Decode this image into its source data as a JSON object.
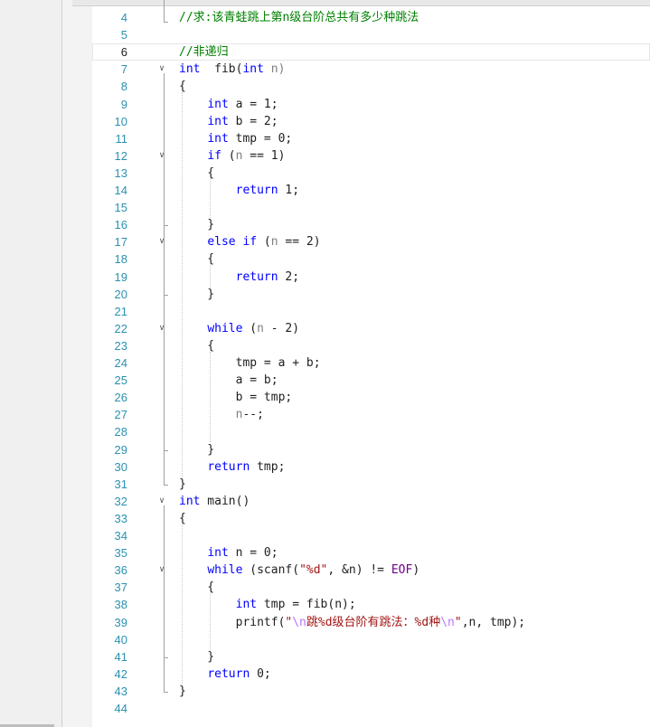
{
  "editor": {
    "lines": [
      {
        "n": "4",
        "segs": [
          {
            "t": "//求:该青蛙跳上第n级台阶总共有多少种跳法",
            "c": "cm"
          }
        ]
      },
      {
        "n": "5",
        "segs": []
      },
      {
        "n": "6",
        "segs": [
          {
            "t": "//非递归",
            "c": "cm"
          }
        ]
      },
      {
        "n": "7",
        "segs": [
          {
            "t": "int",
            "c": "kw"
          },
          {
            "t": "  fib(",
            "c": ""
          },
          {
            "t": "int",
            "c": "kw"
          },
          {
            "t": " n)",
            "c": "gray"
          }
        ]
      },
      {
        "n": "8",
        "segs": [
          {
            "t": "{",
            "c": ""
          }
        ]
      },
      {
        "n": "9",
        "segs": [
          {
            "t": "    ",
            "c": ""
          },
          {
            "t": "int",
            "c": "kw"
          },
          {
            "t": " a = 1;",
            "c": ""
          }
        ]
      },
      {
        "n": "10",
        "segs": [
          {
            "t": "    ",
            "c": ""
          },
          {
            "t": "int",
            "c": "kw"
          },
          {
            "t": " b = 2;",
            "c": ""
          }
        ]
      },
      {
        "n": "11",
        "segs": [
          {
            "t": "    ",
            "c": ""
          },
          {
            "t": "int",
            "c": "kw"
          },
          {
            "t": " tmp = 0;",
            "c": ""
          }
        ]
      },
      {
        "n": "12",
        "segs": [
          {
            "t": "    ",
            "c": ""
          },
          {
            "t": "if",
            "c": "kw"
          },
          {
            "t": " (",
            "c": ""
          },
          {
            "t": "n",
            "c": "gray"
          },
          {
            "t": " == 1)",
            "c": ""
          }
        ]
      },
      {
        "n": "13",
        "segs": [
          {
            "t": "    {",
            "c": ""
          }
        ]
      },
      {
        "n": "14",
        "segs": [
          {
            "t": "        ",
            "c": ""
          },
          {
            "t": "return",
            "c": "kw"
          },
          {
            "t": " 1;",
            "c": ""
          }
        ]
      },
      {
        "n": "15",
        "segs": []
      },
      {
        "n": "16",
        "segs": [
          {
            "t": "    }",
            "c": ""
          }
        ]
      },
      {
        "n": "17",
        "segs": [
          {
            "t": "    ",
            "c": ""
          },
          {
            "t": "else if",
            "c": "kw"
          },
          {
            "t": " (",
            "c": ""
          },
          {
            "t": "n",
            "c": "gray"
          },
          {
            "t": " == 2)",
            "c": ""
          }
        ]
      },
      {
        "n": "18",
        "segs": [
          {
            "t": "    {",
            "c": ""
          }
        ]
      },
      {
        "n": "19",
        "segs": [
          {
            "t": "        ",
            "c": ""
          },
          {
            "t": "return",
            "c": "kw"
          },
          {
            "t": " 2;",
            "c": ""
          }
        ]
      },
      {
        "n": "20",
        "segs": [
          {
            "t": "    }",
            "c": ""
          }
        ]
      },
      {
        "n": "21",
        "segs": []
      },
      {
        "n": "22",
        "segs": [
          {
            "t": "    ",
            "c": ""
          },
          {
            "t": "while",
            "c": "kw"
          },
          {
            "t": " (",
            "c": ""
          },
          {
            "t": "n",
            "c": "gray"
          },
          {
            "t": " - 2)",
            "c": ""
          }
        ]
      },
      {
        "n": "23",
        "segs": [
          {
            "t": "    {",
            "c": ""
          }
        ]
      },
      {
        "n": "24",
        "segs": [
          {
            "t": "        tmp = a + b;",
            "c": ""
          }
        ]
      },
      {
        "n": "25",
        "segs": [
          {
            "t": "        a = b;",
            "c": ""
          }
        ]
      },
      {
        "n": "26",
        "segs": [
          {
            "t": "        b = tmp;",
            "c": ""
          }
        ]
      },
      {
        "n": "27",
        "segs": [
          {
            "t": "        ",
            "c": ""
          },
          {
            "t": "n",
            "c": "gray"
          },
          {
            "t": "--;",
            "c": ""
          }
        ]
      },
      {
        "n": "28",
        "segs": []
      },
      {
        "n": "29",
        "segs": [
          {
            "t": "    }",
            "c": ""
          }
        ]
      },
      {
        "n": "30",
        "segs": [
          {
            "t": "    ",
            "c": ""
          },
          {
            "t": "return",
            "c": "kw"
          },
          {
            "t": " tmp;",
            "c": ""
          }
        ]
      },
      {
        "n": "31",
        "segs": [
          {
            "t": "}",
            "c": ""
          }
        ]
      },
      {
        "n": "32",
        "segs": [
          {
            "t": "int",
            "c": "kw"
          },
          {
            "t": " main()",
            "c": ""
          }
        ]
      },
      {
        "n": "33",
        "segs": [
          {
            "t": "{",
            "c": ""
          }
        ]
      },
      {
        "n": "34",
        "segs": []
      },
      {
        "n": "35",
        "segs": [
          {
            "t": "    ",
            "c": ""
          },
          {
            "t": "int",
            "c": "kw"
          },
          {
            "t": " n = 0;",
            "c": ""
          }
        ]
      },
      {
        "n": "36",
        "segs": [
          {
            "t": "    ",
            "c": ""
          },
          {
            "t": "while",
            "c": "kw"
          },
          {
            "t": " (scanf(",
            "c": ""
          },
          {
            "t": "\"%d\"",
            "c": "str"
          },
          {
            "t": ", &n) != ",
            "c": ""
          },
          {
            "t": "EOF",
            "c": "mac"
          },
          {
            "t": ")",
            "c": ""
          }
        ]
      },
      {
        "n": "37",
        "segs": [
          {
            "t": "    {",
            "c": ""
          }
        ]
      },
      {
        "n": "38",
        "segs": [
          {
            "t": "        ",
            "c": ""
          },
          {
            "t": "int",
            "c": "kw"
          },
          {
            "t": " tmp = fib(n);",
            "c": ""
          }
        ]
      },
      {
        "n": "39",
        "segs": [
          {
            "t": "        printf(",
            "c": ""
          },
          {
            "t": "\"",
            "c": "str"
          },
          {
            "t": "\\n",
            "c": "esc"
          },
          {
            "t": "跳%d级台阶有跳法：%d种",
            "c": "str"
          },
          {
            "t": "\\n",
            "c": "esc"
          },
          {
            "t": "\"",
            "c": "str"
          },
          {
            "t": ",n, tmp);",
            "c": ""
          }
        ]
      },
      {
        "n": "40",
        "segs": []
      },
      {
        "n": "41",
        "segs": [
          {
            "t": "    }",
            "c": ""
          }
        ]
      },
      {
        "n": "42",
        "segs": [
          {
            "t": "    ",
            "c": ""
          },
          {
            "t": "return",
            "c": "kw"
          },
          {
            "t": " 0;",
            "c": ""
          }
        ]
      },
      {
        "n": "43",
        "segs": [
          {
            "t": "}",
            "c": ""
          }
        ]
      },
      {
        "n": "44",
        "segs": []
      }
    ],
    "fold_lines": [
      "7",
      "12",
      "17",
      "22",
      "32",
      "36"
    ],
    "current_line": "6"
  }
}
